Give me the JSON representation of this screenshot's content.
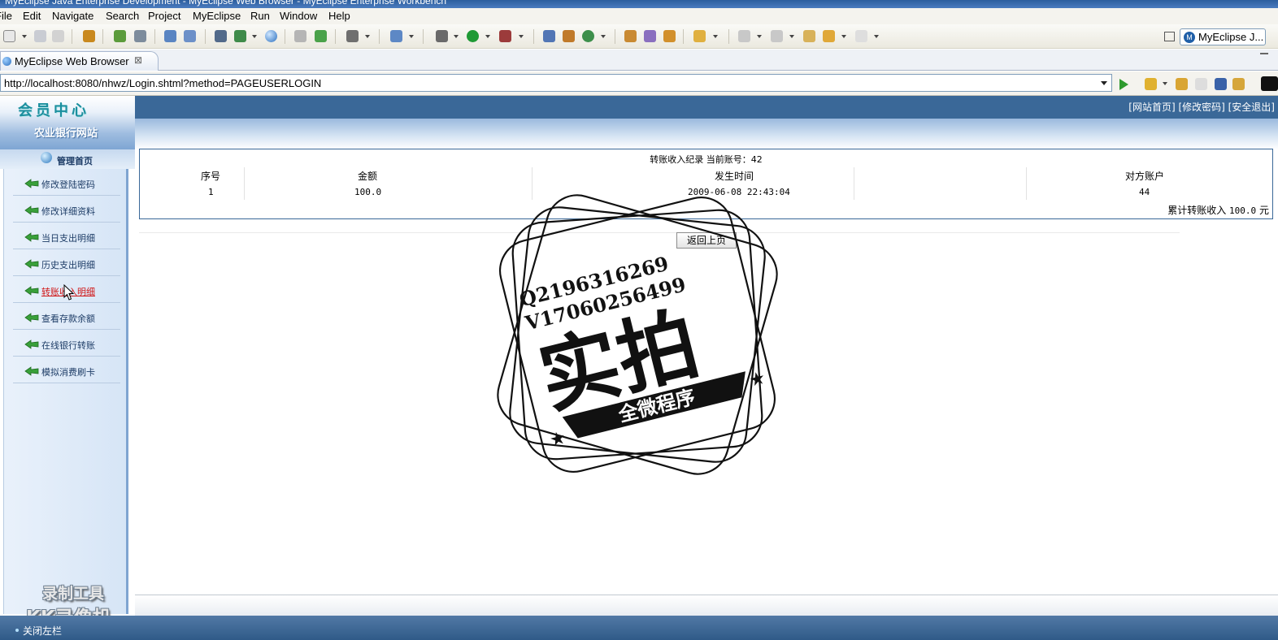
{
  "window": {
    "title": "MyEclipse Java Enterprise Development - MyEclipse Web Browser - MyEclipse Enterprise Workbench"
  },
  "menu": [
    "File",
    "Edit",
    "Navigate",
    "Search",
    "Project",
    "MyEclipse",
    "Run",
    "Window",
    "Help"
  ],
  "toolbar": {
    "perspective_label": "MyEclipse J..."
  },
  "editor_tab": {
    "label": "MyEclipse Web Browser",
    "close_glyph": "⊠"
  },
  "browser": {
    "url": "http://localhost:8080/nhwz/Login.shtml?method=PAGEUSERLOGIN"
  },
  "site": {
    "header_title": "会员中心",
    "site_name": "农业银行网站",
    "top_links": "[网站首页] [修改密码] [安全退出]",
    "mgmt_home": "管理首页",
    "nav": [
      "修改登陆密码",
      "修改详细资料",
      "当日支出明细",
      "历史支出明细",
      "转账收入明细",
      "查看存款余额",
      "在线银行转账",
      "模拟消费刷卡"
    ],
    "active_nav_index": 4,
    "close_left": "关闭左栏"
  },
  "records": {
    "title": "转账收入纪录 当前账号：42",
    "columns": [
      "序号",
      "金额",
      "发生时间",
      "对方账户"
    ],
    "rows": [
      {
        "seq": "1",
        "amount": "100.0",
        "time": "2009-06-08 22:43:04",
        "account": "44"
      }
    ],
    "total_label": "累计转账收入",
    "total_value": "100.0",
    "total_unit": "元",
    "back_button": "返回上页"
  },
  "overlays": {
    "recorder_line1": "录制工具",
    "recorder_line2": "KK录像机",
    "stamp_line1": "Q2196316269",
    "stamp_line2": "V17060256499",
    "stamp_main": "实拍",
    "stamp_banner": "全微程序"
  },
  "colors": {
    "site_header": "#3a6898",
    "nav_active": "#d01515",
    "accent_teal": "#1b8f9e"
  }
}
